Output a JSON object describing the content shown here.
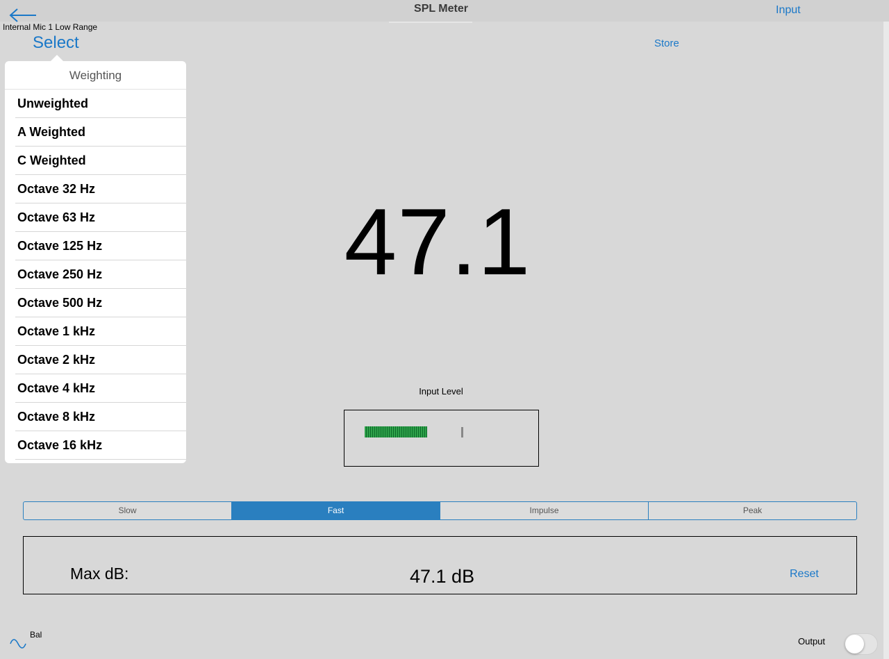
{
  "header": {
    "title": "SPL Meter",
    "input_label": "Input",
    "back_icon": "arrow-left-icon"
  },
  "mic": {
    "label": "Internal Mic 1 Low Range"
  },
  "actions": {
    "select_label": "Select",
    "store_label": "Store"
  },
  "weighting_menu": {
    "title": "Weighting",
    "items": [
      {
        "label": "Unweighted"
      },
      {
        "label": "A Weighted"
      },
      {
        "label": "C Weighted"
      },
      {
        "label": "Octave 32 Hz"
      },
      {
        "label": "Octave 63 Hz"
      },
      {
        "label": "Octave 125 Hz"
      },
      {
        "label": "Octave 250 Hz"
      },
      {
        "label": "Octave 500 Hz"
      },
      {
        "label": "Octave 1 kHz"
      },
      {
        "label": "Octave 2 kHz"
      },
      {
        "label": "Octave 4 kHz"
      },
      {
        "label": "Octave 8 kHz"
      },
      {
        "label": "Octave 16 kHz"
      }
    ]
  },
  "reading": {
    "value": "47.1"
  },
  "input_level": {
    "label": "Input Level",
    "colors": {
      "fill": "#2fa24a",
      "peak": "#888888"
    }
  },
  "response": {
    "options": [
      {
        "label": "Slow"
      },
      {
        "label": "Fast"
      },
      {
        "label": "Impulse"
      },
      {
        "label": "Peak"
      }
    ],
    "selected": "Fast",
    "accent_color": "#2a7fbf"
  },
  "max": {
    "label": "Max dB:",
    "value": "47.1 dB",
    "reset_label": "Reset"
  },
  "footer": {
    "bal_label": "Bal",
    "wave_icon": "sine-wave-icon",
    "output_label": "Output",
    "output_on": false
  }
}
